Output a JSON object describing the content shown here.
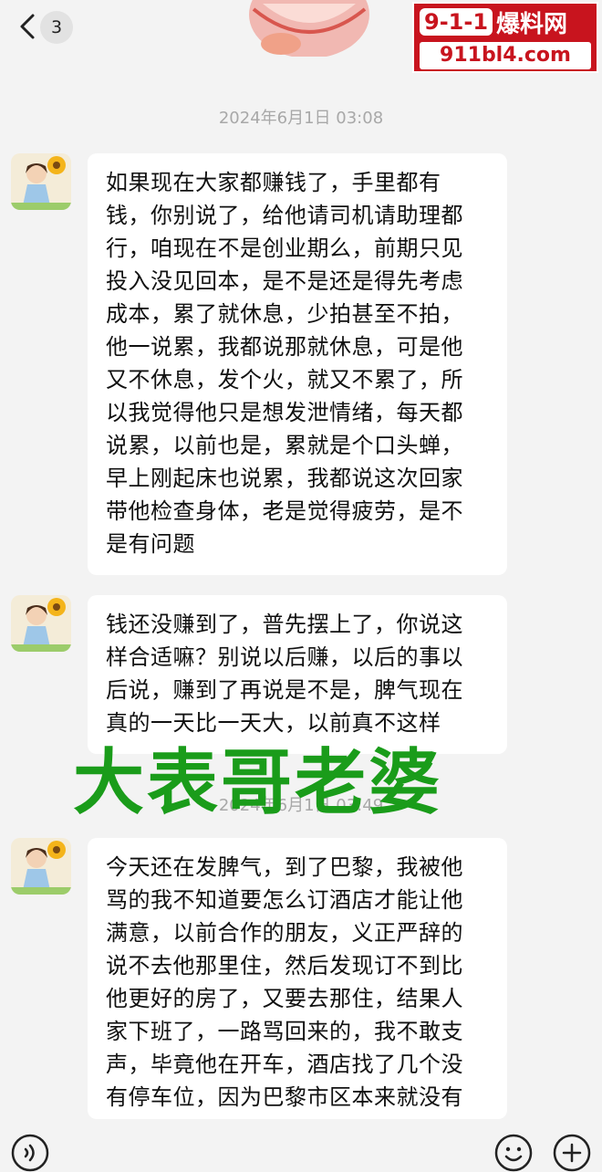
{
  "header": {
    "unread_count": "3",
    "watermark": {
      "num": "9-1-1",
      "cn": "爆料网",
      "url": "911bl4.com"
    }
  },
  "messages": [
    {
      "timestamp": "2024年6月1日 03:08",
      "lines": [
        "如果现在大家都赚钱了，手里都有",
        "钱，你别说了，给他请司机请助理都",
        "行，咱现在不是创业期么，前期只见",
        "投入没见回本，是不是还是得先考虑",
        "成本，累了就休息，少拍甚至不拍，",
        "他一说累，我都说那就休息，可是他",
        "又不休息，发个火，就又不累了，所",
        "以我觉得他只是想发泄情绪，每天都",
        "说累，以前也是，累就是个口头蝉，",
        "早上刚起床也说累，我都说这次回家",
        "带他检查身体，老是觉得疲劳，是不",
        "是有问题"
      ]
    },
    {
      "lines": [
        "钱还没赚到了，普先摆上了，你说这",
        "样合适嘛？别说以后赚，以后的事以",
        "后说，赚到了再说是不是，脾气现在",
        "真的一天比一天大，以前真不这样"
      ]
    },
    {
      "timestamp": "2024年6月1日 03:49",
      "lines": [
        "今天还在发脾气，到了巴黎，我被他",
        "骂的我不知道要怎么订酒店才能让他",
        "满意，以前合作的朋友，义正严辞的",
        "说不去他那里住，然后发现订不到比",
        "他更好的房了，又要去那住，结果人",
        "家下班了，一路骂回来的，我不敢支",
        "声，毕竟他在开车，酒店找了几个没",
        "有停车位，因为巴黎市区本来就没有"
      ]
    }
  ],
  "overlay_text": "大表哥老婆",
  "icons": {
    "back": "chevron-left-icon",
    "voice": "voice-icon",
    "emoji": "emoji-icon",
    "plus": "plus-icon"
  }
}
